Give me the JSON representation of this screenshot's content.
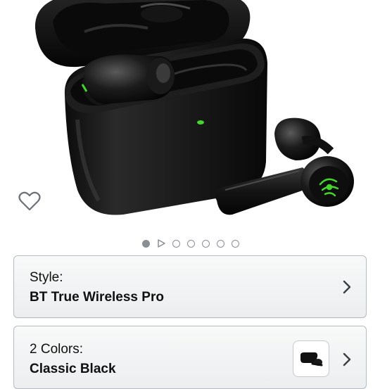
{
  "product": {
    "image_alt": "Razer Hammerhead True Wireless Pro earbuds in charging case",
    "accent_color": "#44d62c"
  },
  "carousel": {
    "total_items": 7,
    "active_index": 0,
    "video_index": 1
  },
  "wishlist": {
    "icon": "heart-outline-icon"
  },
  "variations": {
    "style": {
      "label": "Style:",
      "value": "BT True Wireless Pro"
    },
    "colors": {
      "label": "2 Colors:",
      "value": "Classic Black",
      "swatch_icon": "earbuds-thumbnail"
    }
  },
  "colors": {
    "card_border": "#b7bcc2",
    "text": "#0f1111",
    "dot": "#8a8f94"
  }
}
